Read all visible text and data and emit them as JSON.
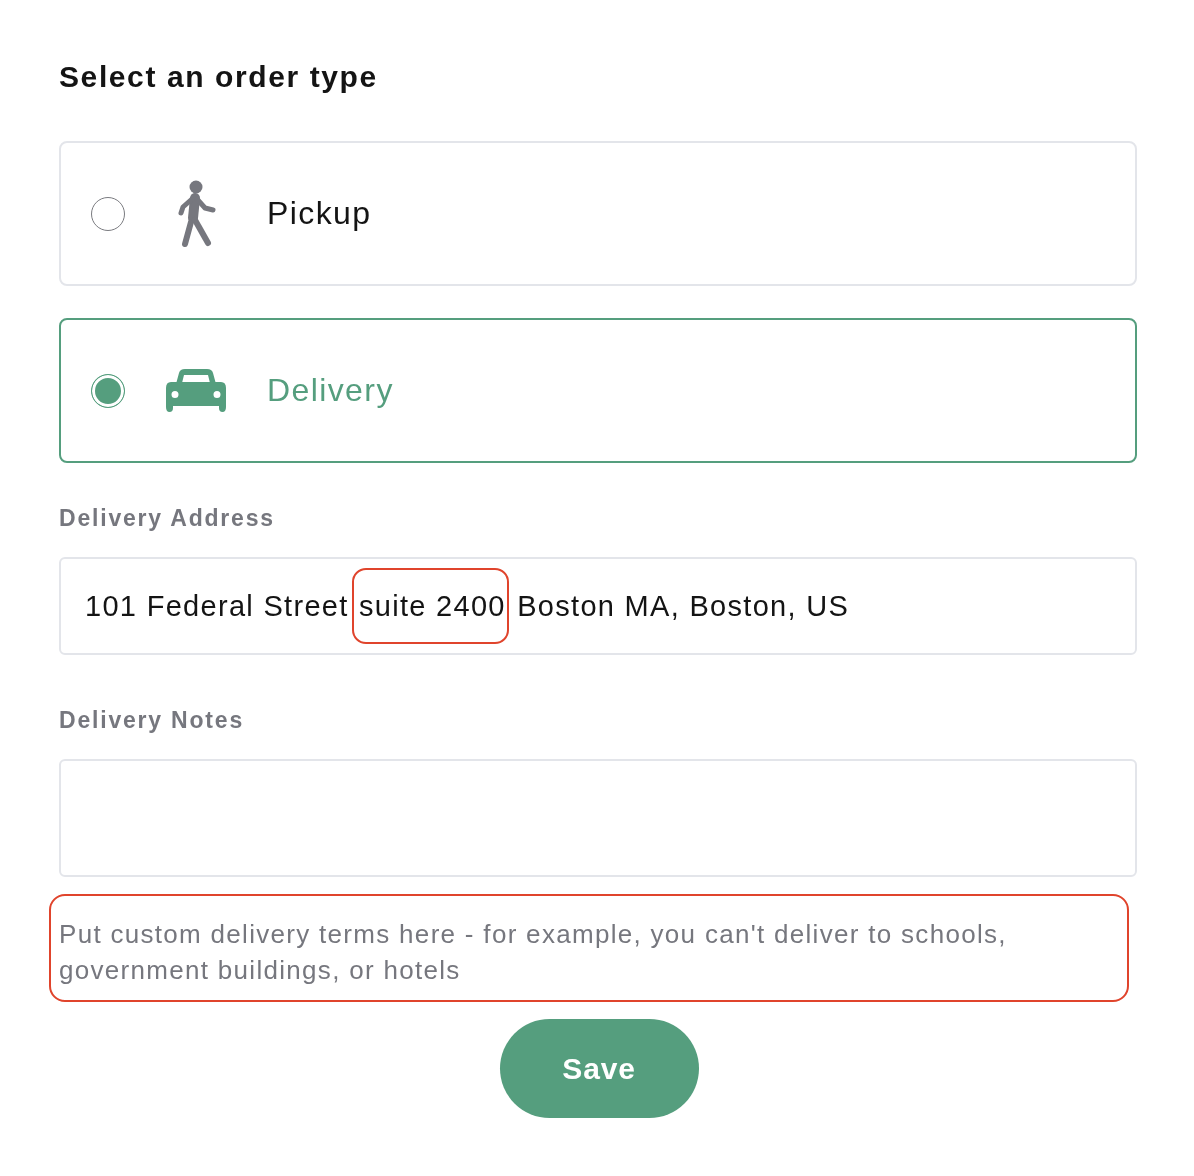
{
  "heading": "Select an order type",
  "order_types": [
    {
      "kind": "pickup",
      "label": "Pickup",
      "selected": false
    },
    {
      "kind": "delivery",
      "label": "Delivery",
      "selected": true
    }
  ],
  "delivery_address": {
    "label": "Delivery Address",
    "value_parts": [
      {
        "text": "101 Federal Street",
        "highlighted": false
      },
      {
        "text": "suite 2400",
        "highlighted": true
      },
      {
        "text": "Boston MA, Boston, US",
        "highlighted": false
      }
    ]
  },
  "delivery_notes": {
    "label": "Delivery Notes"
  },
  "help_text": {
    "text": "Put custom delivery terms here - for example, you can't deliver to schools, government buildings, or hotels",
    "highlighted": true
  },
  "save_button": {
    "label": "Save"
  }
}
